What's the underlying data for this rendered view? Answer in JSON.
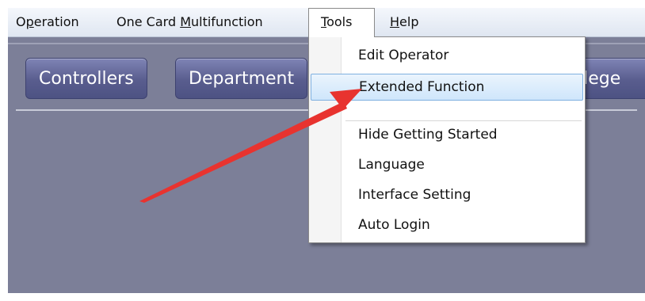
{
  "menubar": {
    "items": [
      {
        "pre": "O",
        "ul": "p",
        "post": "eration"
      },
      {
        "pre": "One Card ",
        "ul": "M",
        "post": "ultifunction"
      },
      {
        "pre": "",
        "ul": "T",
        "post": "ools"
      },
      {
        "pre": "",
        "ul": "H",
        "post": "elp"
      }
    ]
  },
  "toolbar": {
    "buttons": [
      "Controllers",
      "Department",
      "vilege"
    ]
  },
  "tools_menu": {
    "items": [
      "Edit Operator",
      "Extended Function",
      "Hide Getting Started",
      "Language",
      "Interface Setting",
      "Auto Login"
    ],
    "highlighted": "Extended Function"
  },
  "colors": {
    "background": "#7c7f98",
    "button": "#595d8e",
    "highlight": "#cfe6fb",
    "arrow": "#e8332f"
  },
  "icons": {
    "annotation": "red-arrow-icon"
  }
}
